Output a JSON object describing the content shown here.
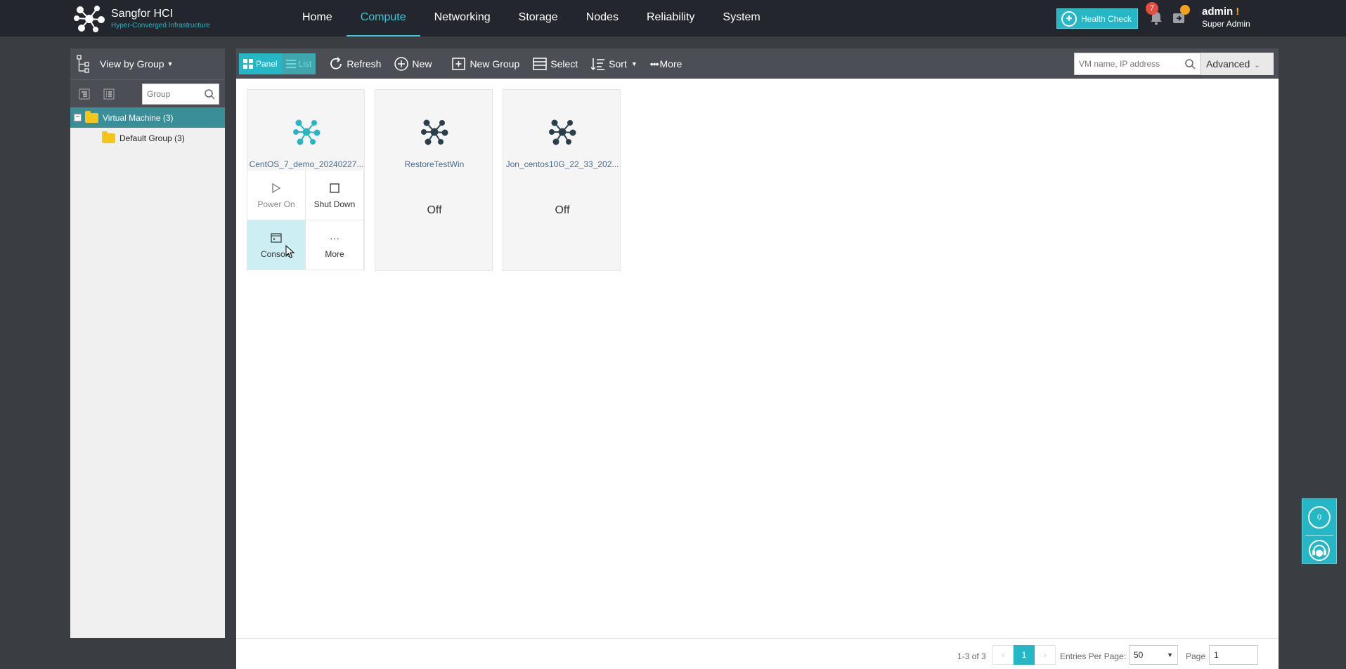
{
  "app": {
    "title": "Sangfor HCI",
    "subtitle": "Hyper-Converged Infrastructure"
  },
  "nav": {
    "items": [
      {
        "label": "Home",
        "active": false
      },
      {
        "label": "Compute",
        "active": true
      },
      {
        "label": "Networking",
        "active": false
      },
      {
        "label": "Storage",
        "active": false
      },
      {
        "label": "Nodes",
        "active": false
      },
      {
        "label": "Reliability",
        "active": false
      },
      {
        "label": "System",
        "active": false
      }
    ]
  },
  "header": {
    "health_check": "Health Check",
    "notifications_count": "7",
    "user_name": "admin",
    "user_warning": "!",
    "user_role": "Super Admin"
  },
  "sidebar": {
    "view_label": "View by Group",
    "group_search_placeholder": "Group",
    "tree": {
      "root": "Virtual Machine (3)",
      "children": [
        "Default Group (3)"
      ]
    }
  },
  "toolbar": {
    "panel_label": "Panel",
    "list_label": "List",
    "refresh": "Refresh",
    "new": "New",
    "new_group": "New Group",
    "select": "Select",
    "sort": "Sort",
    "more": "More",
    "search_placeholder": "VM name, IP address",
    "advanced": "Advanced"
  },
  "vms": [
    {
      "name": "CentOS_7_demo_20240227...",
      "icon_color": "#2bb5c3",
      "actions": {
        "power_on": "Power On",
        "shut_down": "Shut Down",
        "console": "Console",
        "more": "More"
      }
    },
    {
      "name": "RestoreTestWin",
      "state": "Off",
      "icon_color": "#2b3e4c"
    },
    {
      "name": "Jon_centos10G_22_33_202...",
      "state": "Off",
      "icon_color": "#2b3e4c"
    }
  ],
  "footer": {
    "range": "1-3 of 3",
    "current_page": "1",
    "entries_label": "Entries Per Page:",
    "entries_value": "50",
    "page_label": "Page",
    "page_value": "1"
  },
  "float_panel": {
    "count": "0"
  },
  "colors": {
    "accent": "#25b7c5",
    "topbar": "#23272d",
    "toolbar": "#4b4f55"
  }
}
